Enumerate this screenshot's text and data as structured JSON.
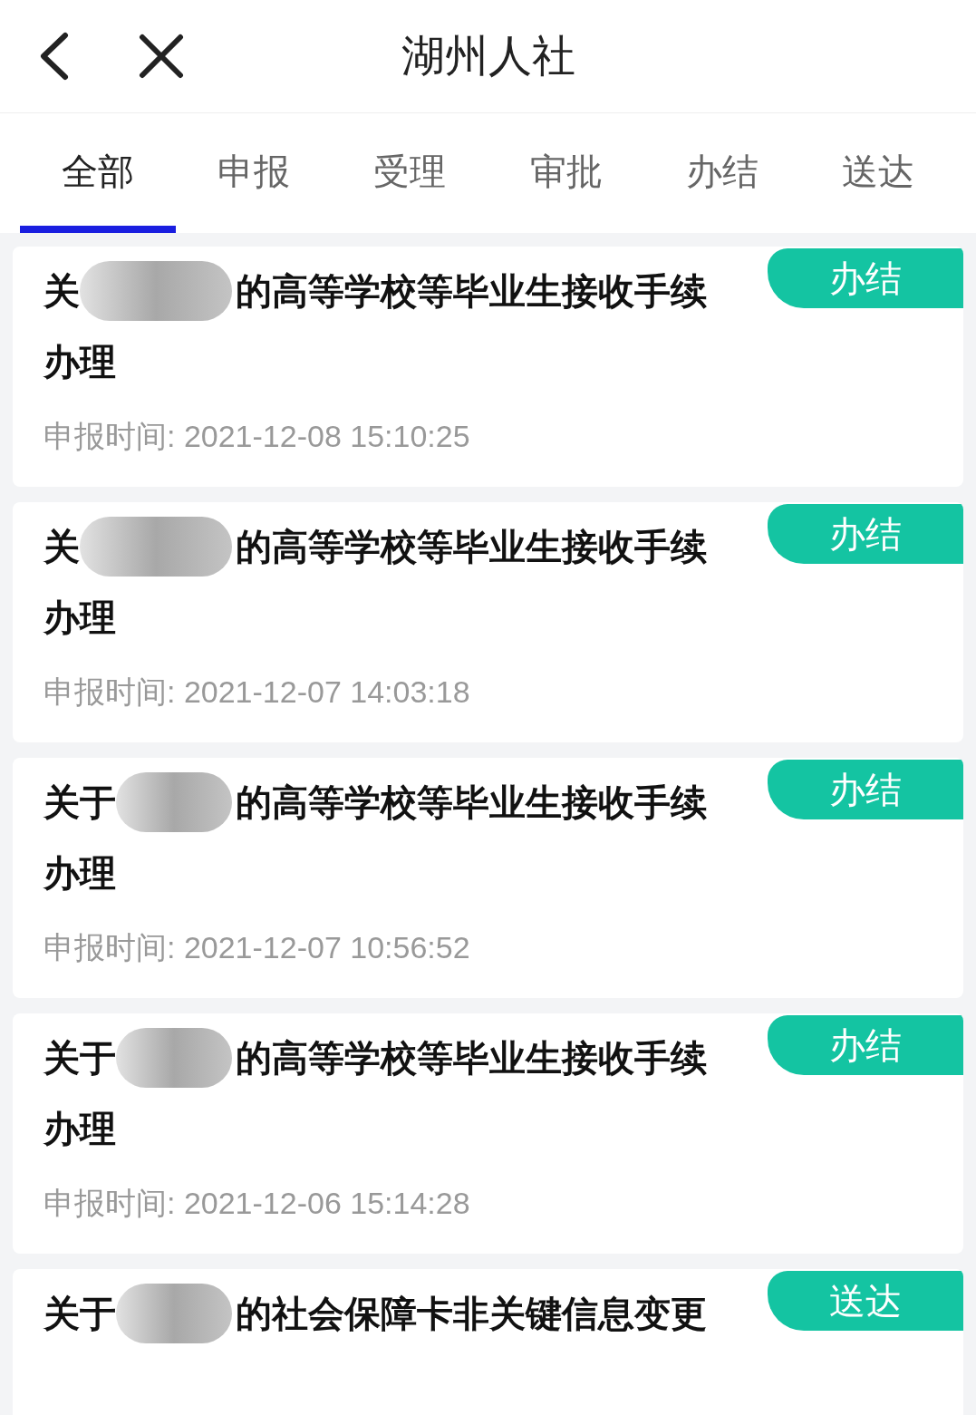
{
  "header": {
    "title": "湖州人社"
  },
  "tabs": [
    {
      "label": "全部",
      "selected": true
    },
    {
      "label": "申报",
      "selected": false
    },
    {
      "label": "受理",
      "selected": false
    },
    {
      "label": "审批",
      "selected": false
    },
    {
      "label": "办结",
      "selected": false
    },
    {
      "label": "送达",
      "selected": false
    }
  ],
  "items": [
    {
      "title_prefix": "关",
      "title_suffix": "的高等学校等毕业生接收手续",
      "title_line2": "办理",
      "status": "办结",
      "date": "申报时间: 2021-12-08 15:10:25"
    },
    {
      "title_prefix": "关",
      "title_suffix": "的高等学校等毕业生接收手续",
      "title_line2": "办理",
      "status": "办结",
      "date": "申报时间: 2021-12-07 14:03:18"
    },
    {
      "title_prefix": "关于",
      "title_suffix": "的高等学校等毕业生接收手续",
      "title_line2": "办理",
      "status": "办结",
      "date": "申报时间: 2021-12-07 10:56:52"
    },
    {
      "title_prefix": "关于",
      "title_suffix": "的高等学校等毕业生接收手续",
      "title_line2": "办理",
      "status": "办结",
      "date": "申报时间: 2021-12-06 15:14:28"
    },
    {
      "title_prefix": "关于",
      "title_suffix": "的社会保障卡非关键信息变更",
      "status": "送达"
    }
  ]
}
